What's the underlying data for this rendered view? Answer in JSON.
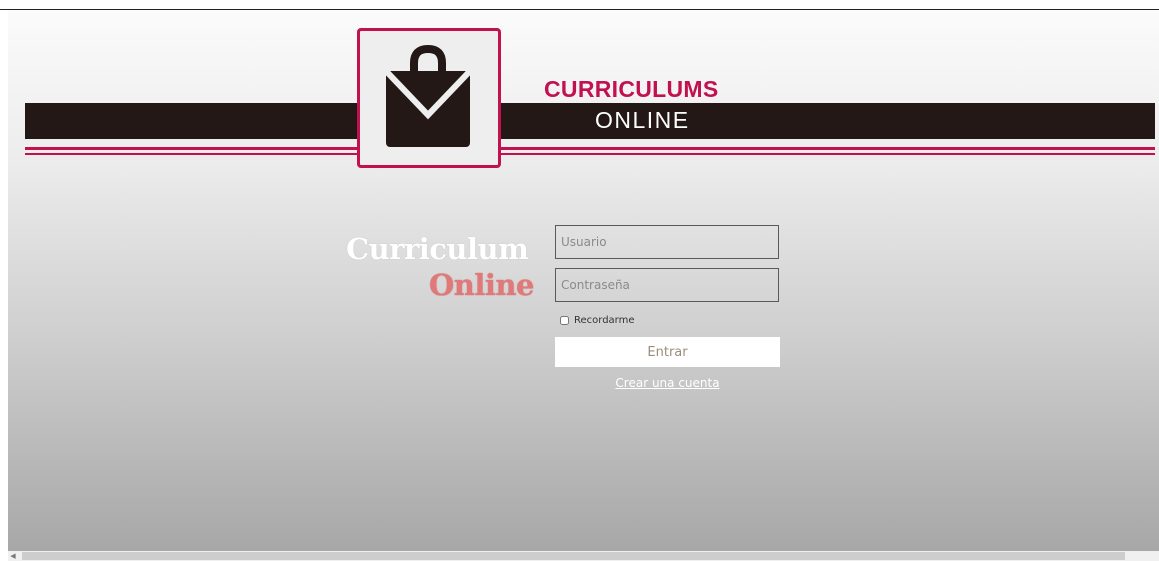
{
  "header": {
    "brand_top": "CURRICULUMS",
    "brand_bottom": "ONLINE",
    "logo_icon": "briefcase-envelope-icon"
  },
  "wordmark": {
    "line1": "Curriculum",
    "line2": "Online"
  },
  "login_form": {
    "username_placeholder": "Usuario",
    "username_value": "",
    "password_placeholder": "Contraseña",
    "password_value": "",
    "remember_label": "Recordarme",
    "remember_checked": false,
    "submit_label": "Entrar",
    "create_account_link": "Crear una cuenta"
  },
  "colors": {
    "accent": "#c1124f",
    "banner": "#231816",
    "wordmark_online": "#e07a7a"
  }
}
